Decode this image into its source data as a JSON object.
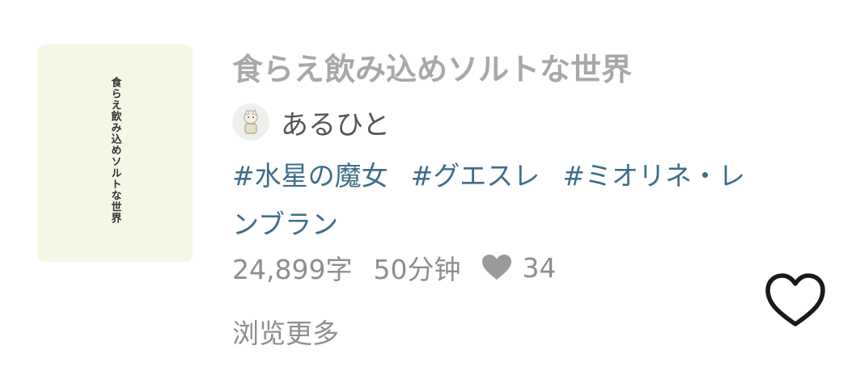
{
  "work": {
    "cover_title": "食らえ飲み込めソルトな世界",
    "title": "食らえ飲み込めソルトな世界",
    "author": "あるひと",
    "tags": [
      "#水星の魔女",
      "#グエスレ",
      "#ミオリネ・レンブラン"
    ],
    "char_count": "24,899字",
    "read_time": "50分钟",
    "likes": "34",
    "more_label": "浏览更多"
  },
  "icons": {
    "avatar": "avatar-icon",
    "likes": "heart-filled-icon",
    "favorite": "heart-outline-icon"
  },
  "colors": {
    "cover_bg": "#f5f7e6",
    "title": "#a8a8a8",
    "tag": "#3e6e89",
    "meta": "#8e8e8e"
  }
}
